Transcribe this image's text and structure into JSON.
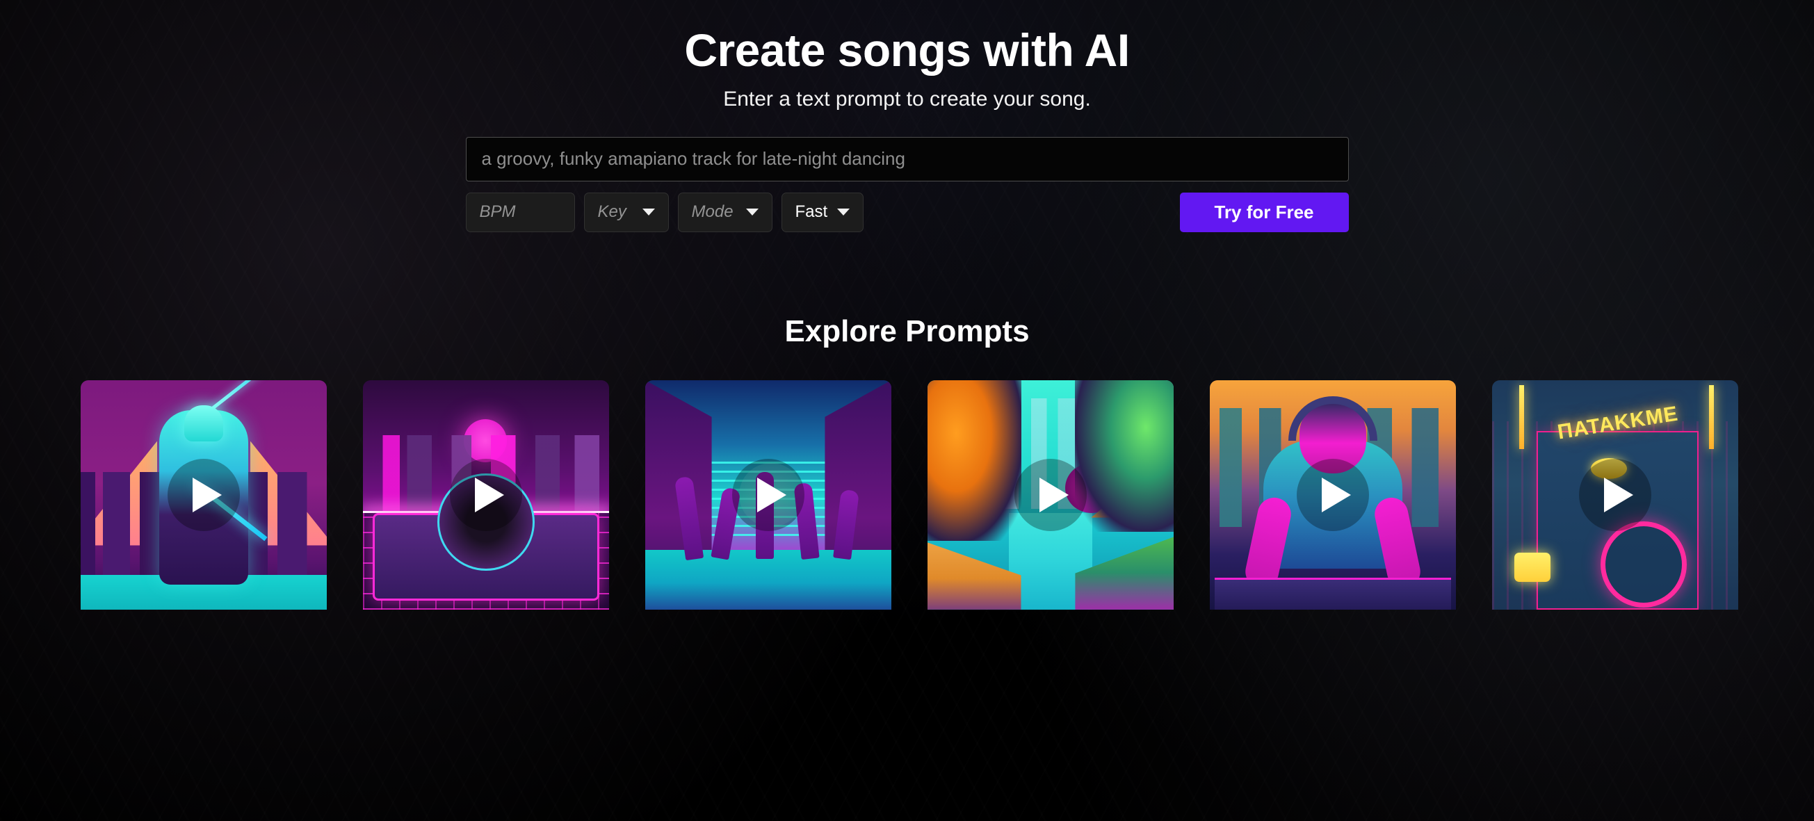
{
  "hero": {
    "title": "Create songs with AI",
    "subtitle": "Enter a text prompt to create your song."
  },
  "prompt_form": {
    "input_placeholder": "a groovy, funky amapiano track for late-night dancing",
    "input_value": "",
    "controls": {
      "bpm_placeholder": "BPM",
      "bpm_value": "",
      "key_label": "Key",
      "mode_label": "Mode",
      "speed_value": "Fast"
    },
    "cta_label": "Try for Free",
    "cta_color": "#6218f2"
  },
  "explore": {
    "title": "Explore Prompts",
    "cards": [
      {
        "name": "neon-samurai",
        "play_label": "Play"
      },
      {
        "name": "synthwave-turntable",
        "play_label": "Play"
      },
      {
        "name": "neon-dancers",
        "play_label": "Play"
      },
      {
        "name": "tropical-canal",
        "play_label": "Play"
      },
      {
        "name": "dj-mixer",
        "play_label": "Play"
      },
      {
        "name": "neon-sign-drums",
        "play_label": "Play",
        "sign_text": "ΠATAKKME"
      }
    ]
  }
}
